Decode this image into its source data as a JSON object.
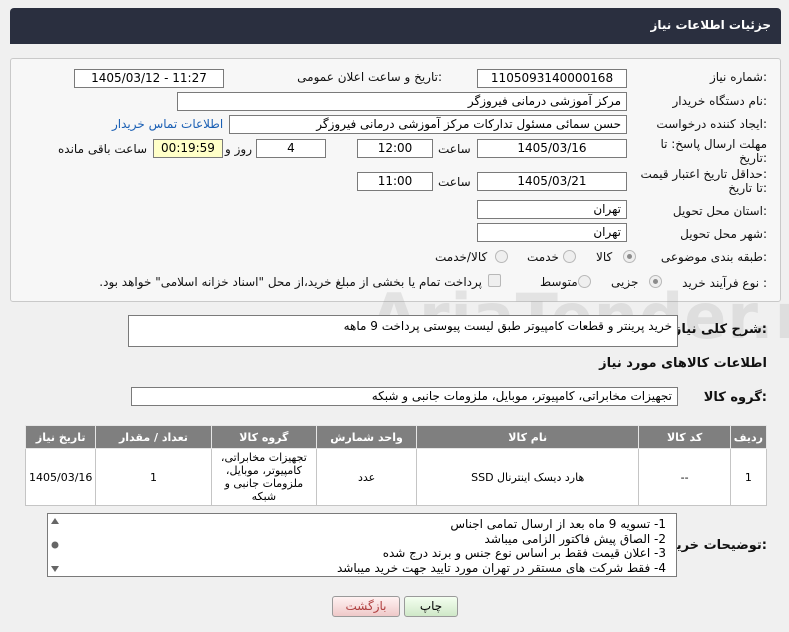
{
  "header": {
    "title": "جزئیات اطلاعات نیاز"
  },
  "form": {
    "need_number_label": "شماره نیاز:",
    "need_number": "1105093140000168",
    "announce_label": "تاریخ و ساعت اعلان عمومی:",
    "announce_value": "1405/03/12 - 11:27",
    "buyer_org_label": "نام دستگاه خریدار:",
    "buyer_org": "مرکز آموزشی درمانی فیروزگر",
    "creator_label": "ایجاد کننده درخواست:",
    "creator": "حسن سمائی مسئول تدارکات مرکز آموزشی درمانی فیروزگر",
    "contact_link": "اطلاعات تماس خریدار",
    "deadline_label_1": "مهلت ارسال پاسخ: تا",
    "deadline_label_2": "تاریخ:",
    "deadline_date": "1405/03/16",
    "hour_label": "ساعت",
    "deadline_time": "12:00",
    "days_value": "4",
    "days_label": "روز و",
    "remaining_time": "00:19:59",
    "remaining_label": "ساعت باقی مانده",
    "validity_label_1": "حداقل تاریخ اعتبار قیمت:",
    "validity_label_2": "تا تاریخ:",
    "validity_date": "1405/03/21",
    "validity_time": "11:00",
    "province_label": "استان محل تحویل:",
    "province": "تهران",
    "city_label": "شهر محل تحویل:",
    "city": "تهران",
    "category_label": "طبقه بندی موضوعی:",
    "category_options": [
      "کالا",
      "خدمت",
      "کالا/خدمت"
    ],
    "category_selected": "کالا",
    "process_label": "نوع فرآیند خرید :",
    "process_options": [
      "جزیی",
      "متوسط"
    ],
    "process_selected": "جزیی",
    "payment_note": "پرداخت تمام یا بخشی از مبلغ خرید،از محل \"اسناد خزانه اسلامی\" خواهد بود."
  },
  "summary": {
    "label": "شرح کلی نیاز:",
    "text": "خرید پرینتر و قطعات کامپیوتر طبق لیست پیوستی پرداخت 9 ماهه"
  },
  "goods": {
    "section_title": "اطلاعات کالاهای مورد نیاز",
    "group_label": "گروه کالا:",
    "group_value": "تجهیزات مخابراتی، کامپیوتر، موبایل، ملزومات جانبی و شبکه",
    "columns": [
      "ردیف",
      "کد کالا",
      "نام کالا",
      "واحد شمارش",
      "گروه کالا",
      "تعداد / مقدار",
      "تاریخ نیاز"
    ],
    "rows": [
      {
        "row": "1",
        "code": "--",
        "name": "هارد دیسک اینترنال SSD",
        "unit": "عدد",
        "group": "تجهیزات مخابراتی، کامپیوتر، موبایل، ملزومات جانبی و شبکه",
        "qty": "1",
        "date": "1405/03/16"
      }
    ]
  },
  "notes": {
    "label": "توضیحات خریدار:",
    "lines": [
      "1- تسویه 9 ماه بعد از ارسال تمامی اجناس",
      "2- الصاق پیش فاکتور الزامی میباشد",
      "3- اعلان قیمت فقط بر اساس نوع جنس و برند درج شده",
      "4- فقط شرکت های مستقر در تهران مورد تایید جهت خرید میباشد"
    ]
  },
  "buttons": {
    "print": "چاپ",
    "back": "بازگشت"
  },
  "watermark": "AriaTender.net",
  "colors": {
    "header_bg": "#2a2f3f",
    "table_header_bg": "#7f7f7f",
    "link": "#1a5fb4"
  }
}
